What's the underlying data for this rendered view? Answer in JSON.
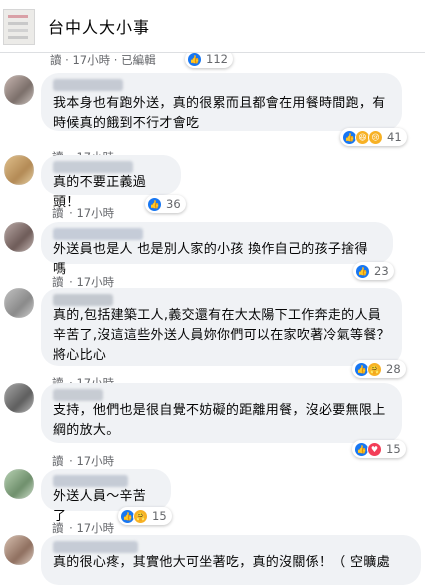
{
  "header": {
    "title": "台中人大小事"
  },
  "top": {
    "meta_read": "讀",
    "meta_time": "17小時",
    "meta_edited": "已編輯",
    "reaction_count": "112"
  },
  "comments": [
    {
      "text": "我本身也有跑外送，真的很累而且都會在用餐時間跑，有時候真的餓到不行才會吃",
      "read": "讀",
      "time": "17小時",
      "reactions": [
        "like",
        "haha",
        "sad"
      ],
      "count": "41"
    },
    {
      "text": "真的不要正義過頭！",
      "read": "讀",
      "time": "17小時",
      "reactions": [
        "like"
      ],
      "count": "36"
    },
    {
      "text": "外送員也是人 也是別人家的小孩 換作自己的孩子捨得嗎",
      "read": "讀",
      "time": "17小時",
      "reactions": [
        "like"
      ],
      "count": "23"
    },
    {
      "text": "真的,包括建築工人,義交還有在大太陽下工作奔走的人員辛苦了,沒這這些外送人員妳你們可以在家吹著冷氣等餐？將心比心",
      "read": "讀",
      "time": "17小時",
      "reactions": [
        "like",
        "care"
      ],
      "count": "28"
    },
    {
      "text": "支持，他們也是很自覺不妨礙的距離用餐，沒必要無限上綱的放大。",
      "read": "讀",
      "time": "17小時",
      "reactions": [
        "like",
        "love"
      ],
      "count": "15"
    },
    {
      "text": "外送人員～辛苦了",
      "read": "讀",
      "time": "17小時",
      "reactions": [
        "like",
        "care"
      ],
      "count": "15"
    },
    {
      "text": "真的很心疼，其實他大可坐著吃，真的沒關係！（ 空曠處",
      "read": "",
      "time": "",
      "reactions": [],
      "count": ""
    }
  ],
  "colors": {
    "accent": "#1877f2",
    "bubble": "#f0f2f5",
    "meta": "#65676b"
  }
}
